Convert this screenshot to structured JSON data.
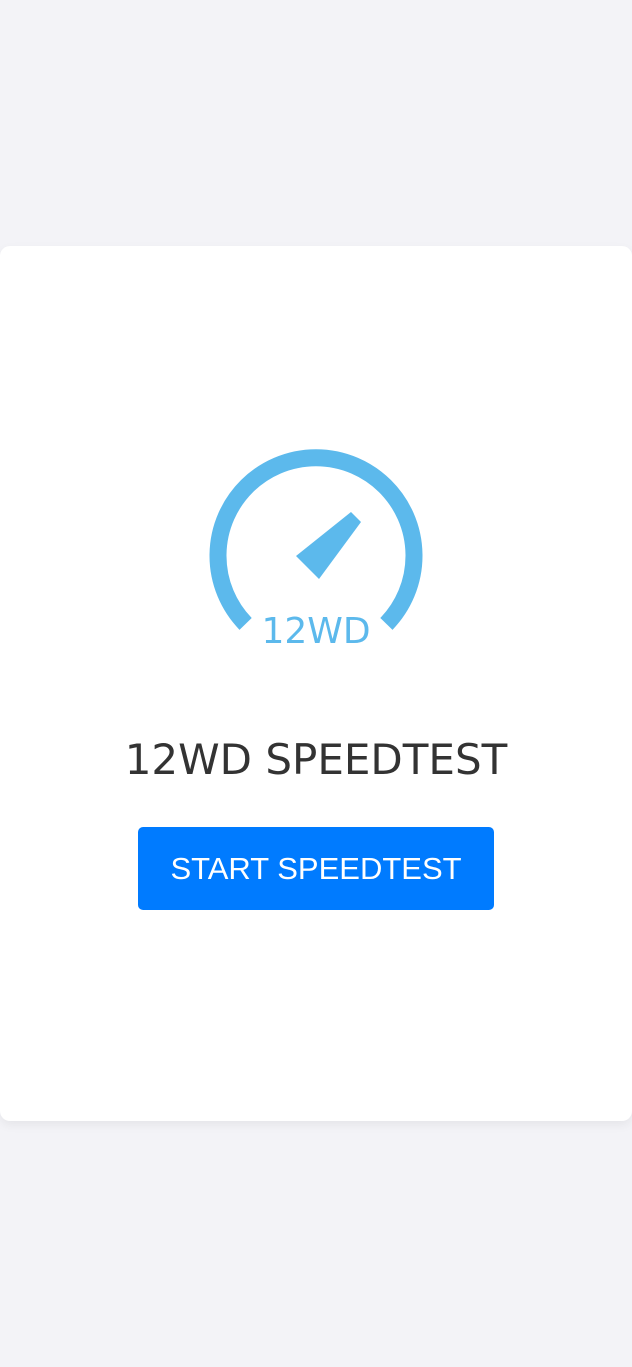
{
  "logo": {
    "icon": "speedometer-icon",
    "text": "12WD",
    "color": "#5cb9ec"
  },
  "title": "12WD SPEEDTEST",
  "start_button": {
    "label": "START SPEEDTEST",
    "color": "#007bff"
  },
  "colors": {
    "page_background": "#f3f3f7",
    "card_background": "#ffffff",
    "title_text": "#333333"
  }
}
